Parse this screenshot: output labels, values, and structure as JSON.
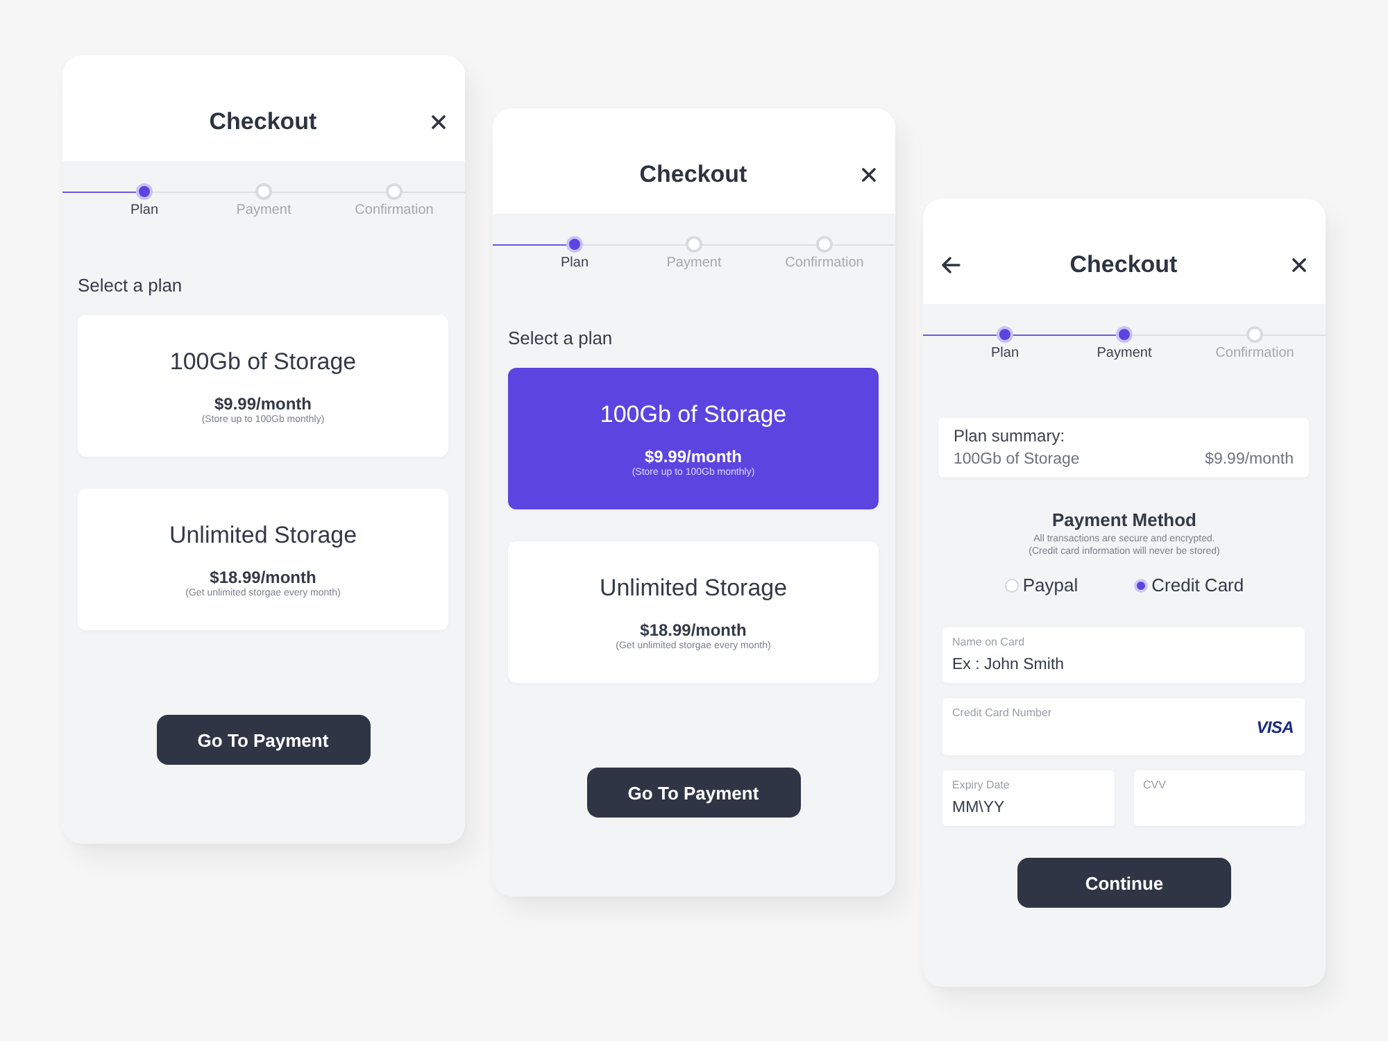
{
  "screens": [
    {
      "kind": "plan",
      "title": "Checkout",
      "back": false,
      "steps": [
        {
          "label": "Plan",
          "active": true
        },
        {
          "label": "Payment",
          "active": false
        },
        {
          "label": "Confirmation",
          "active": false
        }
      ],
      "heading": "Select a plan",
      "plans": [
        {
          "name": "100Gb of Storage",
          "price": "$9.99/month",
          "note": "(Store up to 100Gb monthly)",
          "selected": false
        },
        {
          "name": "Unlimited Storage",
          "price": "$18.99/month",
          "note": "(Get unlimited storgae every month)",
          "selected": false
        }
      ],
      "button": "Go To Payment"
    },
    {
      "kind": "plan",
      "title": "Checkout",
      "back": false,
      "steps": [
        {
          "label": "Plan",
          "active": true
        },
        {
          "label": "Payment",
          "active": false
        },
        {
          "label": "Confirmation",
          "active": false
        }
      ],
      "heading": "Select a plan",
      "plans": [
        {
          "name": "100Gb of Storage",
          "price": "$9.99/month",
          "note": "(Store up to 100Gb monthly)",
          "selected": true
        },
        {
          "name": "Unlimited Storage",
          "price": "$18.99/month",
          "note": "(Get unlimited storgae every month)",
          "selected": false
        }
      ],
      "button": "Go To Payment"
    },
    {
      "kind": "payment",
      "title": "Checkout",
      "back": true,
      "steps": [
        {
          "label": "Plan",
          "active": true
        },
        {
          "label": "Payment",
          "active": true
        },
        {
          "label": "Confirmation",
          "active": false
        }
      ],
      "summary": {
        "label": "Plan summary:",
        "plan": "100Gb of Storage",
        "price": "$9.99/month"
      },
      "method": {
        "title": "Payment Method",
        "notes": [
          "All transactions are secure and encrypted.",
          "(Credit card information will never be stored)"
        ],
        "options": [
          {
            "label": "Paypal",
            "selected": false
          },
          {
            "label": "Credit Card",
            "selected": true
          }
        ]
      },
      "fields": [
        {
          "label": "Name on Card",
          "placeholder": "Ex : John Smith"
        },
        {
          "label": "Credit Card Number",
          "brand": "VISA"
        },
        {
          "label": "Expiry Date",
          "placeholder": "MM\\YY"
        },
        {
          "label": "CVV"
        }
      ],
      "button": "Continue"
    }
  ]
}
